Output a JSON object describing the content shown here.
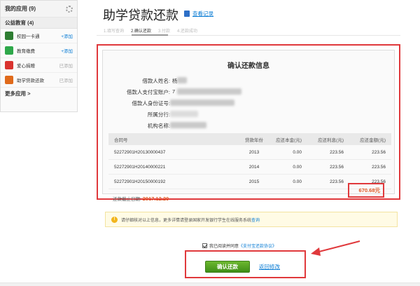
{
  "sidebar": {
    "my_apps": "我的应用 (9)",
    "category": "公益教育 (4)",
    "items": [
      {
        "name": "校园一卡通",
        "action": "+添加",
        "icon_color": "#2e7d32",
        "added": false
      },
      {
        "name": "教育缴费",
        "action": "+添加",
        "icon_color": "#2ea84a",
        "added": false
      },
      {
        "name": "爱心捐赠",
        "action": "已添加",
        "icon_color": "#d9332f",
        "added": true
      },
      {
        "name": "助学贷款还款",
        "action": "已添加",
        "icon_color": "#e06a1b",
        "added": true
      }
    ],
    "more": "更多应用 >"
  },
  "header": {
    "title": "助学贷款还款",
    "view_records": "查看记录"
  },
  "steps": [
    "1.填写查询",
    "2.确认还款",
    "3.付款",
    "4.还款成功"
  ],
  "panel": {
    "title": "确认还款信息",
    "fields": [
      {
        "label": "借款人姓名:",
        "value": "杨"
      },
      {
        "label": "借款人支付宝账户:",
        "value": "7"
      },
      {
        "label": "借款人身份证号:",
        "value": ""
      },
      {
        "label": "所属分行:",
        "value": ""
      },
      {
        "label": "机构名称:",
        "value": ""
      }
    ],
    "table": {
      "headers": [
        "合同号",
        "贷款年份",
        "应还本金(元)",
        "应还利息(元)",
        "应还金额(元)"
      ],
      "rows": [
        [
          "52272901H20130000437",
          "2013",
          "0.00",
          "223.56",
          "223.56"
        ],
        [
          "52272901H20140000221",
          "2014",
          "0.00",
          "223.56",
          "223.56"
        ],
        [
          "52272901H20150000192",
          "2015",
          "0.00",
          "223.56",
          "223.56"
        ]
      ]
    },
    "deadline_label": "还款截止日期:",
    "deadline": "2017.12.20",
    "total": "670.68元"
  },
  "notice": {
    "text": "请仔细核对以上信息，更多详情请登录国家开发银行学生在线服务系统",
    "link": "查询"
  },
  "agreement": {
    "text": "我已阅读并同意",
    "link": "《支付宝还款协议》"
  },
  "actions": {
    "confirm": "确认还款",
    "back": "返回修改"
  },
  "colors": {
    "highlight": "#e0393c",
    "link": "#0a7cd4",
    "button": "#4f9e22",
    "amount": "#e05520"
  }
}
